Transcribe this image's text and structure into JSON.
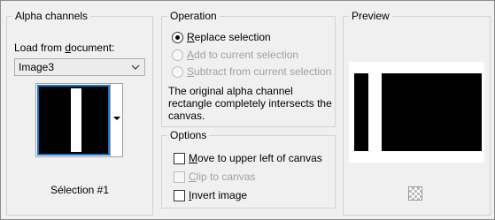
{
  "alpha": {
    "title": "Alpha channels",
    "load_label_pre": "Load from ",
    "load_label_ul": "d",
    "load_label_post": "ocument:",
    "document_value": "Image3",
    "selection_name": "Sélection #1"
  },
  "operation": {
    "title": "Operation",
    "options": [
      {
        "ul": "R",
        "rest": "eplace selection",
        "checked": true,
        "enabled": true
      },
      {
        "ul": "A",
        "rest": "dd to current selection",
        "checked": false,
        "enabled": false
      },
      {
        "ul": "S",
        "rest": "ubtract from current selection",
        "checked": false,
        "enabled": false
      }
    ],
    "description": "The original alpha channel rectangle completely intersects the canvas."
  },
  "options": {
    "title": "Options",
    "items": [
      {
        "ul": "M",
        "rest": "ove to upper left of canvas",
        "checked": false,
        "enabled": true
      },
      {
        "ul": "C",
        "rest": "lip to canvas",
        "checked": false,
        "enabled": false
      },
      {
        "ul": "I",
        "rest": "nvert image",
        "checked": false,
        "enabled": true
      }
    ]
  },
  "preview": {
    "title": "Preview",
    "background_icon": "transparency-checker-icon"
  },
  "colors": {
    "selection_border": "#1c73c5",
    "disabled_text": "#a0a0a0"
  }
}
